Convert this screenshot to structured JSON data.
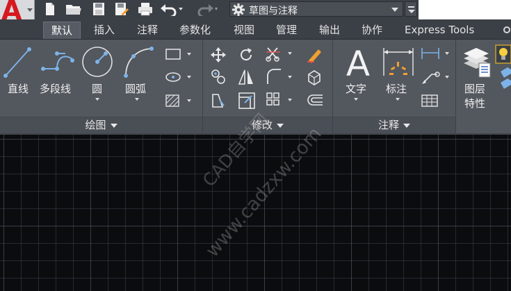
{
  "titlebar": {
    "app_logo": "A",
    "workspace": "草图与注释",
    "icons": [
      "new-icon",
      "open-icon",
      "save-icon",
      "save-as-icon",
      "plot-icon",
      "undo-icon",
      "redo-icon",
      "gear-icon"
    ]
  },
  "tabs": [
    {
      "label": "默认",
      "active": true
    },
    {
      "label": "插入"
    },
    {
      "label": "注释"
    },
    {
      "label": "参数化"
    },
    {
      "label": "视图"
    },
    {
      "label": "管理"
    },
    {
      "label": "输出"
    },
    {
      "label": "协作"
    },
    {
      "label": "Express Tools"
    }
  ],
  "panels": {
    "draw": {
      "title": "绘图",
      "tools": {
        "line": "直线",
        "polyline": "多段线",
        "circle": "圆",
        "arc": "圆弧"
      }
    },
    "modify": {
      "title": "修改"
    },
    "annotation": {
      "title": "注释",
      "tools": {
        "text": "文字",
        "dimension": "标注"
      },
      "text_icon_glyph": "A"
    },
    "layers": {
      "label_line1": "图层",
      "label_line2": "特性"
    }
  },
  "watermark": {
    "line1": "CAD自学网",
    "line2": "www.cadzxw.com"
  },
  "colors": {
    "accent_red": "#d5191f",
    "ribbon_bg": "#53575e",
    "canvas_bg": "#0b0c0e",
    "icon_blue": "#7db3e8",
    "icon_orange": "#f0a030"
  }
}
